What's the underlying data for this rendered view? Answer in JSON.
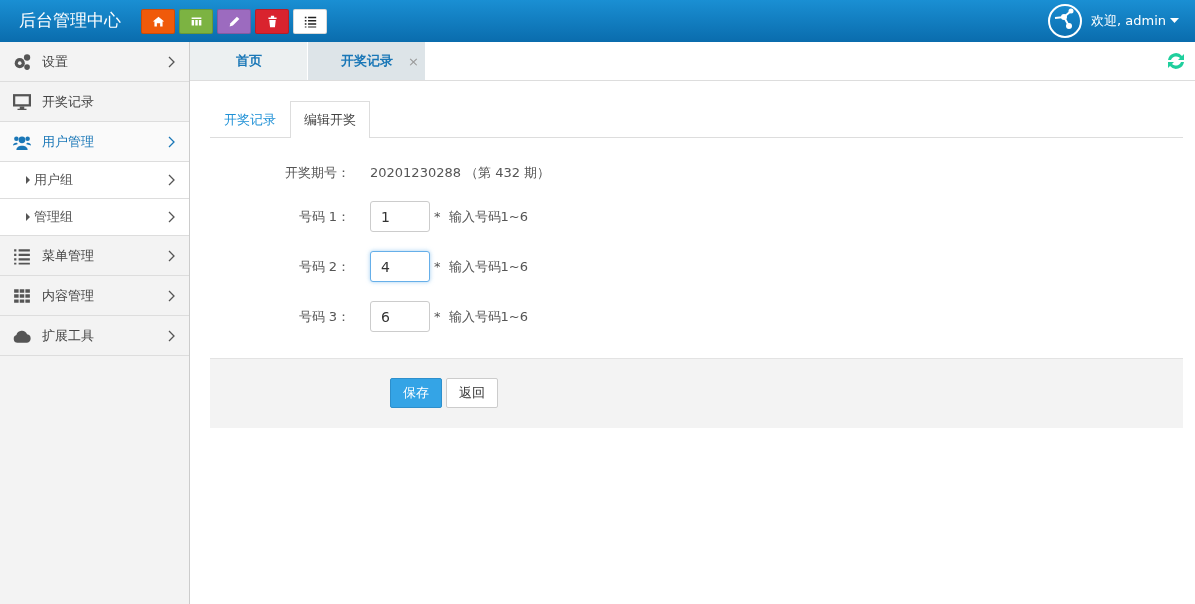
{
  "header": {
    "title": "后台管理中心",
    "toolbar": [
      {
        "color": "#f05a0a"
      },
      {
        "color": "#7cb342"
      },
      {
        "color": "#9c6bbf"
      },
      {
        "color": "#d9232e"
      },
      {
        "color": "#ffffff"
      }
    ],
    "user": "欢迎, admin"
  },
  "sidebar": {
    "items": [
      {
        "label": "设置",
        "expanded": false,
        "has_arrow": true
      },
      {
        "label": "开奖记录",
        "expanded": false,
        "has_arrow": false
      },
      {
        "label": "用户管理",
        "expanded": true,
        "has_arrow": true,
        "children": [
          {
            "label": "用户组"
          },
          {
            "label": "管理组"
          }
        ]
      },
      {
        "label": "菜单管理",
        "expanded": false,
        "has_arrow": true
      },
      {
        "label": "内容管理",
        "expanded": false,
        "has_arrow": true
      },
      {
        "label": "扩展工具",
        "expanded": false,
        "has_arrow": true
      }
    ]
  },
  "page_tabs": [
    {
      "label": "首页",
      "selected": false,
      "closable": false
    },
    {
      "label": "开奖记录",
      "selected": true,
      "closable": true,
      "close": "×"
    }
  ],
  "tabs": [
    {
      "label": "开奖记录",
      "selected": false
    },
    {
      "label": "编辑开奖",
      "selected": true
    }
  ],
  "form": {
    "period_label": "开奖期号：",
    "period_value": "20201230288 （第 432 期）",
    "fields": [
      {
        "label": "号码 1：",
        "value": "1",
        "focused": false,
        "required": "*",
        "hint": "输入号码1~6"
      },
      {
        "label": "号码 2：",
        "value": "4",
        "focused": true,
        "required": "*",
        "hint": "输入号码1~6"
      },
      {
        "label": "号码 3：",
        "value": "6",
        "focused": false,
        "required": "*",
        "hint": "输入号码1~6"
      }
    ],
    "buttons": [
      {
        "label": "保存",
        "kind": "primary"
      },
      {
        "label": "返回",
        "kind": "default"
      }
    ]
  }
}
